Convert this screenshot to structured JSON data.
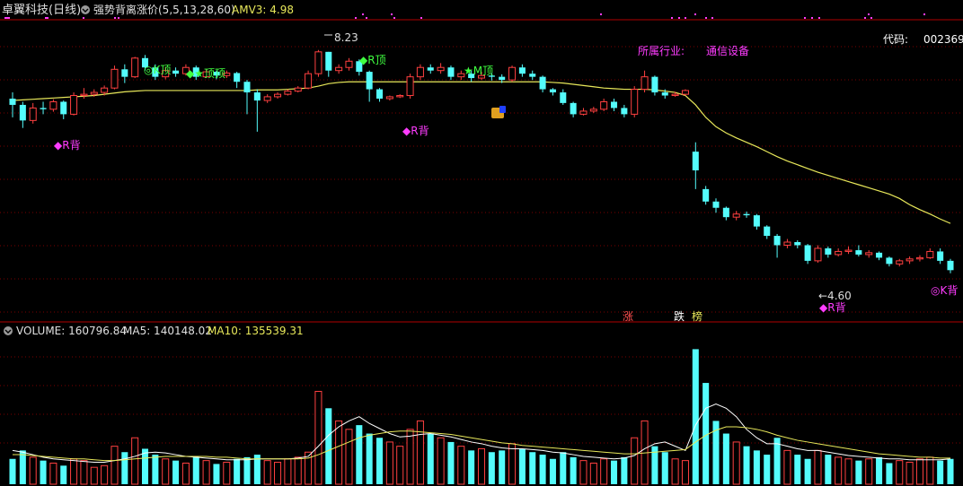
{
  "header": {
    "stock_title": "卓翼科技(日线)",
    "indicator": "强势背离涨价(5,5,13,28,60)",
    "amv_label": "AMV3: 4.98",
    "industry_label": "所属行业:",
    "industry_value": "通信设备",
    "code_label": "代码:",
    "code_value": "002369"
  },
  "volume_header": {
    "volume": "VOLUME: 160796.84",
    "ma5": "MA5: 140148.02",
    "ma10": "MA10: 135539.31"
  },
  "markers": {
    "high": "8.23",
    "low": "←4.60",
    "labels": [
      "◆R背",
      "◎K顶",
      "◆★顶顶",
      "◆R顶",
      "◆R背",
      "★M顶",
      "◆R背",
      "◎K背"
    ],
    "events": [
      "涨",
      "跌",
      "榜"
    ]
  },
  "colors": {
    "up": "#ff4040",
    "down": "#54fcfc",
    "ma": "#e8e85a",
    "vol_ma5": "#ffffff",
    "vol_ma10": "#e8e85a",
    "magenta": "#ff3cff",
    "green": "#40ff40"
  },
  "chart_data": [
    {
      "type": "candlestick",
      "title": "卓翼科技(日线)",
      "ylim": [
        4.0,
        8.6
      ],
      "candles": [
        [
          7.45,
          7.35,
          7.55,
          7.15
        ],
        [
          7.35,
          7.1,
          7.4,
          6.98
        ],
        [
          7.1,
          7.3,
          7.38,
          7.05
        ],
        [
          7.3,
          7.28,
          7.4,
          7.2
        ],
        [
          7.28,
          7.4,
          7.44,
          7.24
        ],
        [
          7.4,
          7.2,
          7.42,
          7.12
        ],
        [
          7.2,
          7.5,
          7.55,
          7.18
        ],
        [
          7.5,
          7.52,
          7.62,
          7.45
        ],
        [
          7.52,
          7.55,
          7.6,
          7.48
        ],
        [
          7.55,
          7.62,
          7.66,
          7.5
        ],
        [
          7.62,
          7.92,
          7.98,
          7.6
        ],
        [
          7.92,
          7.8,
          8.0,
          7.7
        ],
        [
          7.8,
          8.1,
          8.12,
          7.78
        ],
        [
          8.1,
          7.95,
          8.15,
          7.9
        ],
        [
          7.95,
          7.8,
          8.0,
          7.75
        ],
        [
          7.8,
          7.9,
          7.96,
          7.76
        ],
        [
          7.9,
          7.85,
          7.95,
          7.8
        ],
        [
          7.85,
          7.95,
          8.0,
          7.82
        ],
        [
          7.95,
          7.8,
          7.98,
          7.75
        ],
        [
          7.8,
          7.88,
          7.92,
          7.78
        ],
        [
          7.88,
          7.82,
          7.9,
          7.76
        ],
        [
          7.82,
          7.86,
          7.9,
          7.78
        ],
        [
          7.86,
          7.72,
          7.88,
          7.62
        ],
        [
          7.72,
          7.55,
          7.75,
          7.2
        ],
        [
          7.55,
          7.42,
          7.6,
          6.92
        ],
        [
          7.42,
          7.48,
          7.52,
          7.38
        ],
        [
          7.48,
          7.52,
          7.55,
          7.45
        ],
        [
          7.52,
          7.57,
          7.6,
          7.5
        ],
        [
          7.57,
          7.62,
          7.65,
          7.55
        ],
        [
          7.62,
          7.85,
          7.9,
          7.6
        ],
        [
          7.85,
          8.2,
          8.23,
          7.8
        ],
        [
          8.2,
          7.9,
          8.2,
          7.8
        ],
        [
          7.9,
          7.95,
          8.0,
          7.85
        ],
        [
          7.95,
          8.05,
          8.1,
          7.9
        ],
        [
          8.05,
          7.88,
          8.08,
          7.82
        ],
        [
          7.88,
          7.6,
          7.9,
          7.4
        ],
        [
          7.6,
          7.45,
          7.62,
          7.4
        ],
        [
          7.45,
          7.48,
          7.5,
          7.42
        ],
        [
          7.48,
          7.5,
          7.52,
          7.46
        ],
        [
          7.5,
          7.8,
          7.85,
          7.45
        ],
        [
          7.8,
          7.95,
          8.0,
          7.75
        ],
        [
          7.95,
          7.9,
          8.0,
          7.85
        ],
        [
          7.9,
          7.95,
          8.02,
          7.85
        ],
        [
          7.95,
          7.8,
          7.98,
          7.75
        ],
        [
          7.8,
          7.85,
          7.9,
          7.75
        ],
        [
          7.85,
          7.78,
          7.9,
          7.72
        ],
        [
          7.78,
          7.82,
          7.88,
          7.75
        ],
        [
          7.82,
          7.8,
          7.86,
          7.74
        ],
        [
          7.8,
          7.75,
          7.84,
          7.7
        ],
        [
          7.75,
          7.95,
          7.98,
          7.72
        ],
        [
          7.95,
          7.85,
          8.0,
          7.8
        ],
        [
          7.85,
          7.8,
          7.9,
          7.75
        ],
        [
          7.8,
          7.6,
          7.82,
          7.55
        ],
        [
          7.6,
          7.55,
          7.62,
          7.5
        ],
        [
          7.55,
          7.38,
          7.6,
          7.35
        ],
        [
          7.38,
          7.2,
          7.4,
          7.15
        ],
        [
          7.2,
          7.25,
          7.3,
          7.18
        ],
        [
          7.25,
          7.28,
          7.32,
          7.22
        ],
        [
          7.28,
          7.4,
          7.45,
          7.25
        ],
        [
          7.4,
          7.3,
          7.45,
          7.25
        ],
        [
          7.3,
          7.2,
          7.35,
          7.15
        ],
        [
          7.2,
          7.6,
          7.65,
          7.15
        ],
        [
          7.6,
          7.8,
          7.9,
          7.55
        ],
        [
          7.8,
          7.55,
          7.82,
          7.5
        ],
        [
          7.55,
          7.5,
          7.6,
          7.45
        ],
        [
          7.5,
          7.52,
          7.56,
          7.48
        ],
        [
          7.52,
          7.58,
          7.6,
          7.5
        ],
        [
          6.6,
          6.3,
          6.75,
          6.0
        ],
        [
          6.0,
          5.8,
          6.05,
          5.75
        ],
        [
          5.8,
          5.7,
          5.85,
          5.62
        ],
        [
          5.7,
          5.55,
          5.72,
          5.5
        ],
        [
          5.55,
          5.6,
          5.65,
          5.5
        ],
        [
          5.6,
          5.58,
          5.64,
          5.54
        ],
        [
          5.58,
          5.4,
          5.6,
          5.35
        ],
        [
          5.4,
          5.25,
          5.42,
          5.2
        ],
        [
          5.25,
          5.1,
          5.28,
          4.9
        ],
        [
          5.1,
          5.15,
          5.2,
          5.05
        ],
        [
          5.15,
          5.1,
          5.18,
          5.05
        ],
        [
          5.1,
          4.85,
          5.12,
          4.8
        ],
        [
          4.85,
          5.05,
          5.1,
          4.82
        ],
        [
          5.05,
          4.95,
          5.08,
          4.9
        ],
        [
          4.95,
          5.0,
          5.05,
          4.92
        ],
        [
          5.0,
          5.02,
          5.08,
          4.96
        ],
        [
          5.02,
          4.95,
          5.1,
          4.92
        ],
        [
          4.95,
          4.98,
          5.02,
          4.9
        ],
        [
          4.98,
          4.9,
          5.0,
          4.86
        ],
        [
          4.9,
          4.8,
          4.92,
          4.76
        ],
        [
          4.8,
          4.85,
          4.88,
          4.76
        ],
        [
          4.85,
          4.88,
          4.92,
          4.8
        ],
        [
          4.88,
          4.9,
          4.94,
          4.84
        ],
        [
          4.9,
          5.0,
          5.05,
          4.88
        ],
        [
          5.0,
          4.85,
          5.05,
          4.8
        ],
        [
          4.85,
          4.7,
          4.88,
          4.65
        ]
      ],
      "ma60": [
        7.42,
        7.43,
        7.44,
        7.45,
        7.46,
        7.47,
        7.48,
        7.49,
        7.5,
        7.52,
        7.54,
        7.56,
        7.57,
        7.58,
        7.58,
        7.58,
        7.58,
        7.58,
        7.58,
        7.58,
        7.58,
        7.58,
        7.58,
        7.58,
        7.59,
        7.59,
        7.59,
        7.6,
        7.61,
        7.62,
        7.65,
        7.69,
        7.71,
        7.72,
        7.72,
        7.72,
        7.72,
        7.72,
        7.72,
        7.72,
        7.72,
        7.72,
        7.72,
        7.72,
        7.72,
        7.72,
        7.72,
        7.72,
        7.72,
        7.72,
        7.72,
        7.72,
        7.72,
        7.71,
        7.7,
        7.68,
        7.66,
        7.64,
        7.62,
        7.61,
        7.6,
        7.6,
        7.6,
        7.59,
        7.57,
        7.55,
        7.5,
        7.35,
        7.15,
        7.0,
        6.9,
        6.82,
        6.75,
        6.68,
        6.6,
        6.52,
        6.45,
        6.39,
        6.33,
        6.27,
        6.22,
        6.17,
        6.12,
        6.07,
        6.02,
        5.97,
        5.92,
        5.85,
        5.75,
        5.67,
        5.6,
        5.52,
        5.45
      ]
    },
    {
      "type": "bar",
      "title": "VOLUME",
      "ylim": [
        0,
        170000
      ],
      "volumes": [
        30000,
        40000,
        32000,
        28000,
        25000,
        22000,
        30000,
        28000,
        20000,
        22000,
        45000,
        38000,
        55000,
        42000,
        35000,
        30000,
        28000,
        25000,
        32000,
        28000,
        24000,
        26000,
        30000,
        32000,
        35000,
        28000,
        26000,
        30000,
        32000,
        38000,
        110000,
        90000,
        75000,
        65000,
        70000,
        60000,
        55000,
        50000,
        45000,
        65000,
        75000,
        60000,
        55000,
        50000,
        45000,
        40000,
        42000,
        38000,
        40000,
        48000,
        42000,
        38000,
        35000,
        30000,
        38000,
        32000,
        28000,
        25000,
        30000,
        28000,
        32000,
        55000,
        75000,
        45000,
        38000,
        30000,
        28000,
        160000,
        120000,
        75000,
        60000,
        50000,
        45000,
        40000,
        35000,
        55000,
        40000,
        35000,
        30000,
        40000,
        35000,
        32000,
        30000,
        28000,
        30000,
        32000,
        25000,
        28000,
        26000,
        30000,
        32000,
        28000,
        30000
      ],
      "ma5": [
        40000,
        38000,
        35000,
        32000,
        30000,
        29000,
        28000,
        27000,
        26000,
        26000,
        28000,
        30000,
        33000,
        37000,
        38000,
        37000,
        35000,
        33000,
        32000,
        31000,
        30000,
        29000,
        29000,
        29000,
        30000,
        30000,
        30000,
        30000,
        31000,
        33000,
        45000,
        58000,
        68000,
        75000,
        80000,
        72000,
        66000,
        60000,
        56000,
        57000,
        59000,
        60000,
        58000,
        56000,
        53000,
        50000,
        48000,
        45000,
        43000,
        42000,
        42000,
        41000,
        40000,
        38000,
        37000,
        35000,
        33000,
        32000,
        31000,
        30000,
        31000,
        34000,
        42000,
        48000,
        50000,
        45000,
        40000,
        70000,
        90000,
        95000,
        90000,
        80000,
        65000,
        55000,
        48000,
        48000,
        45000,
        42000,
        40000,
        40000,
        38000,
        36000,
        34000,
        33000,
        32000,
        31000,
        30000,
        30000,
        29000,
        29000,
        29000,
        29000,
        30000
      ],
      "ma10": [
        35000,
        35000,
        34000,
        33000,
        32000,
        31000,
        30000,
        30000,
        29000,
        28000,
        28000,
        29000,
        30000,
        31000,
        32000,
        33000,
        33000,
        33000,
        33000,
        33000,
        32000,
        32000,
        31000,
        30000,
        30000,
        30000,
        30000,
        30000,
        30000,
        31000,
        35000,
        40000,
        45000,
        50000,
        55000,
        58000,
        60000,
        62000,
        63000,
        63000,
        62000,
        61000,
        60000,
        59000,
        57000,
        55000,
        53000,
        51000,
        49000,
        48000,
        46000,
        45000,
        44000,
        43000,
        42000,
        41000,
        40000,
        39000,
        38000,
        37000,
        36000,
        36000,
        37000,
        38000,
        39000,
        40000,
        41000,
        50000,
        58000,
        64000,
        68000,
        68000,
        67000,
        65000,
        62000,
        58000,
        55000,
        52000,
        50000,
        48000,
        46000,
        44000,
        42000,
        40000,
        38000,
        36000,
        35000,
        34000,
        33000,
        32000,
        32000,
        31000,
        31000
      ]
    }
  ]
}
